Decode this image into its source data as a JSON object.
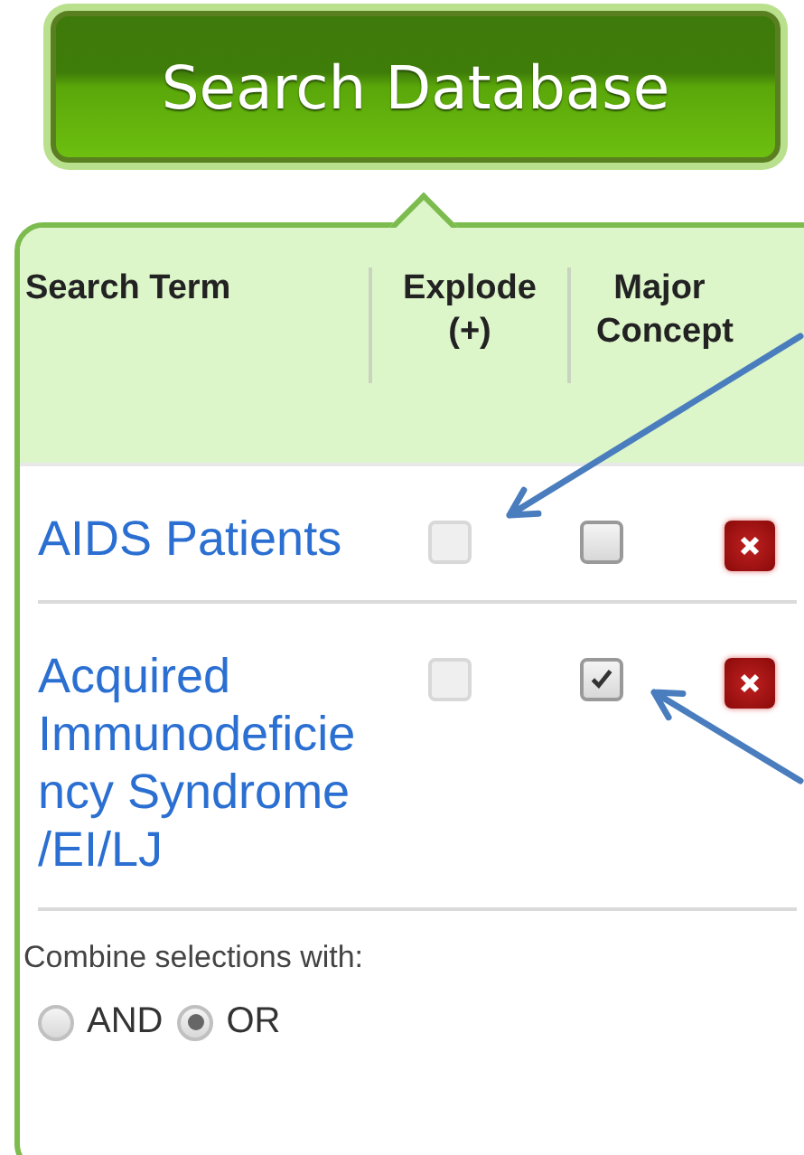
{
  "search_button": {
    "label": "Search Database"
  },
  "columns": [
    {
      "label": "Search Term"
    },
    {
      "label": "Explode (+)"
    },
    {
      "label": "Major Concept"
    }
  ],
  "terms": [
    {
      "label": "AIDS Patients",
      "explode": {
        "checked": false,
        "disabled": true
      },
      "major": {
        "checked": false,
        "disabled": false
      }
    },
    {
      "label": "Acquired Immunodeficiency Syndrome /EI/LJ",
      "explode": {
        "checked": false,
        "disabled": true
      },
      "major": {
        "checked": true,
        "disabled": false
      }
    }
  ],
  "combine": {
    "label": "Combine selections with:",
    "options": [
      {
        "label": "AND",
        "selected": false
      },
      {
        "label": "OR",
        "selected": true
      }
    ]
  }
}
